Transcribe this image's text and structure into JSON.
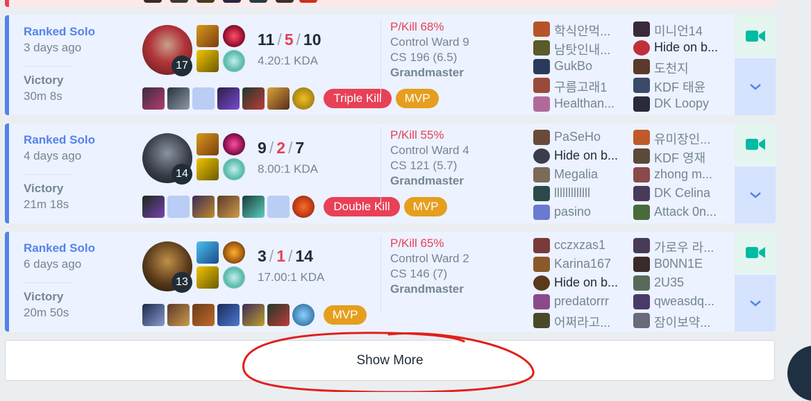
{
  "colors": {
    "win_accent": "#5383e8",
    "loss_accent": "#e84057",
    "mvp": "#e59e1e",
    "kill_badge": "#e84057",
    "video": "#00bba3"
  },
  "matches": [
    {
      "queue": "Ranked Solo",
      "ago": "3 days ago",
      "result": "Victory",
      "duration": "30m 8s",
      "level": "17",
      "kills": "11",
      "deaths": "5",
      "assists": "10",
      "ratio": "4.20:1 KDA",
      "pkill": "P/Kill 68%",
      "wards": "Control Ward 9",
      "cs": "CS 196 (6.5)",
      "tier": "Grandmaster",
      "badges": [
        "Triple Kill",
        "MVP"
      ],
      "team1": [
        "학식안먹...",
        "남탓인내...",
        "GukBo",
        "구름고래1",
        "Healthan..."
      ],
      "team2": [
        "미니언14",
        "Hide on b...",
        "도천지",
        "KDF 태윤",
        "DK Loopy"
      ]
    },
    {
      "queue": "Ranked Solo",
      "ago": "4 days ago",
      "result": "Victory",
      "duration": "21m 18s",
      "level": "14",
      "kills": "9",
      "deaths": "2",
      "assists": "7",
      "ratio": "8.00:1 KDA",
      "pkill": "P/Kill 55%",
      "wards": "Control Ward 4",
      "cs": "CS 121 (5.7)",
      "tier": "Grandmaster",
      "badges": [
        "Double Kill",
        "MVP"
      ],
      "team1": [
        "PaSeHo",
        "Hide on b...",
        "Megalia",
        "lllllllllllll",
        "pasino"
      ],
      "team2": [
        "유미장인...",
        "KDF 영재",
        "zhong m...",
        "DK Celina",
        "Attack 0n..."
      ]
    },
    {
      "queue": "Ranked Solo",
      "ago": "6 days ago",
      "result": "Victory",
      "duration": "20m 50s",
      "level": "13",
      "kills": "3",
      "deaths": "1",
      "assists": "14",
      "ratio": "17.00:1 KDA",
      "pkill": "P/Kill 65%",
      "wards": "Control Ward 2",
      "cs": "CS 146 (7)",
      "tier": "Grandmaster",
      "badges": [
        "MVP"
      ],
      "team1": [
        "cczxzas1",
        "Karina167",
        "Hide on b...",
        "predatorrr",
        "어쩌라고..."
      ],
      "team2": [
        "가로우 라...",
        "B0NN1E",
        "2U35",
        "qweasdq...",
        "잠이보약..."
      ]
    }
  ],
  "show_more": "Show More"
}
